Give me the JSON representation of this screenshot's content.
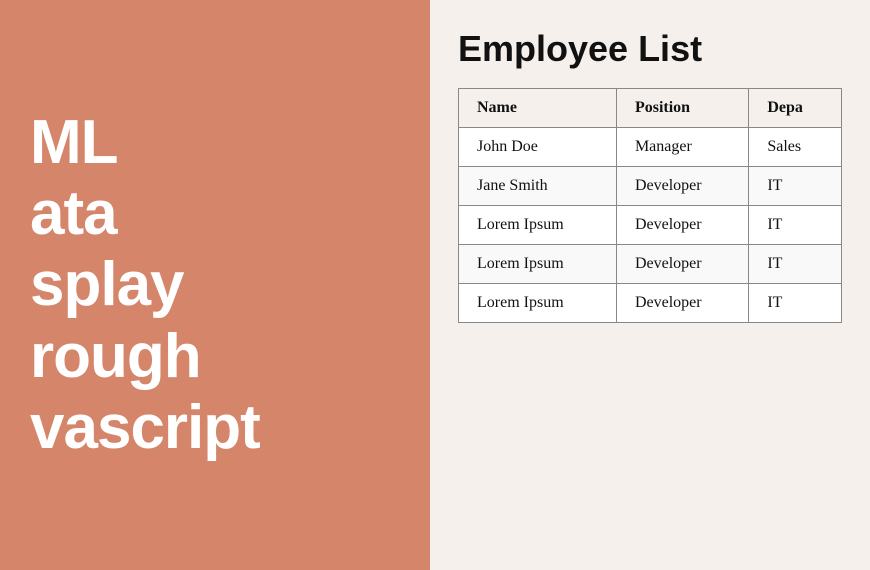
{
  "left": {
    "title_line1": "ML",
    "title_line2": "ata",
    "title_line3": "splay",
    "title_line4": "rough",
    "title_line5": "vascript"
  },
  "right": {
    "section_title": "Employee List",
    "table": {
      "headers": [
        "Name",
        "Position",
        "Depa"
      ],
      "rows": [
        {
          "name": "John Doe",
          "position": "Manager",
          "department": "Sales"
        },
        {
          "name": "Jane Smith",
          "position": "Developer",
          "department": "IT"
        },
        {
          "name": "Lorem Ipsum",
          "position": "Developer",
          "department": "IT"
        },
        {
          "name": "Lorem Ipsum",
          "position": "Developer",
          "department": "IT"
        },
        {
          "name": "Lorem Ipsum",
          "position": "Developer",
          "department": "IT"
        }
      ]
    }
  }
}
